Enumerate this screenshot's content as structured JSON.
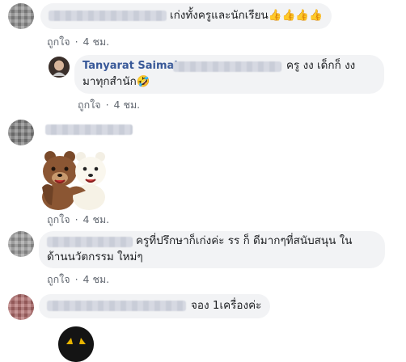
{
  "comments": [
    {
      "text": "เก่งทั้งครูและนักเรียน👍👍👍👍",
      "like": "ถูกใจ",
      "time": "4 ชม."
    },
    {
      "name": "Tanyarat Saimai",
      "line1": "ครู งง เด็กก็ งง",
      "line2": "มาทุกสำนัก🤣",
      "like": "ถูกใจ",
      "time": "4 ชม."
    },
    {
      "like": "ถูกใจ",
      "time": "4 ชม."
    },
    {
      "line1": "ครูที่ปรึกษาก็เก่งค่ะ รร ก็ ดีมากๆที่สนับสนุน ใน",
      "line2": "ด้านนวัตกรรม ใหม่ๆ",
      "like": "ถูกใจ",
      "time": "4 ชม."
    },
    {
      "text": "จอง 1เครื่องค่ะ"
    }
  ],
  "sep": "·"
}
